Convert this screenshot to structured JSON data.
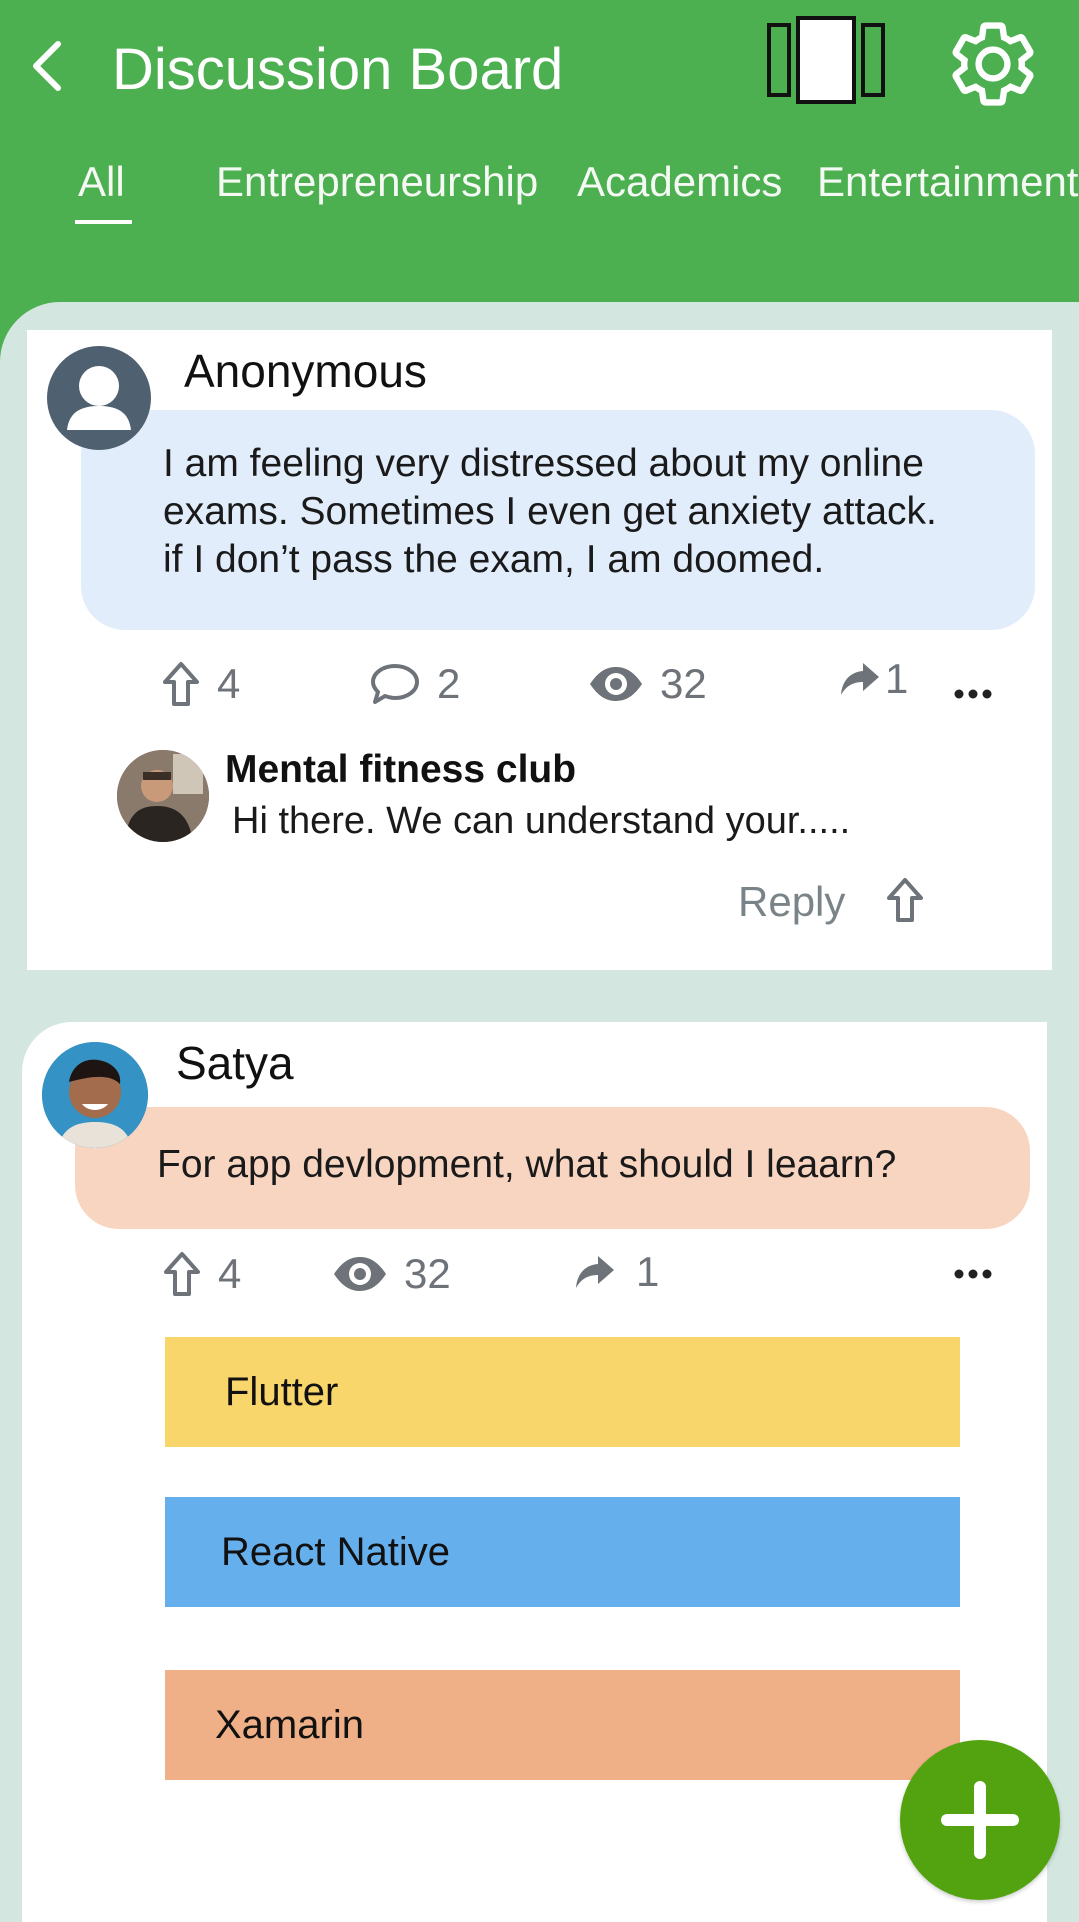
{
  "header": {
    "title": "Discussion Board",
    "tabs": [
      "All",
      "Entrepreneurship",
      "Academics",
      "Entertainment"
    ],
    "active_tab": "All"
  },
  "posts": [
    {
      "author": "Anonymous",
      "text_lines": [
        "I am feeling very distressed about my online",
        "exams. Sometimes I even get anxiety attack.",
        "if I don’t pass the exam, I am doomed."
      ],
      "upvotes": "4",
      "comments": "2",
      "views": "32",
      "shares": "1",
      "bubble_color": "#e2edfb",
      "comment": {
        "author": "Mental fitness club",
        "text": "Hi there. We can understand your.....",
        "reply_label": "Reply"
      }
    },
    {
      "author": "Satya",
      "text": "For app devlopment, what should I leaarn?",
      "upvotes": "4",
      "views": "32",
      "shares": "1",
      "bubble_color": "#f8d5c1",
      "poll_options": [
        "Flutter",
        "React Native",
        "Xamarin"
      ]
    }
  ],
  "colors": {
    "header_green": "#4caf50",
    "fab_green": "#52a30f",
    "background": "#d3e6e0",
    "flutter": "#f9d66b",
    "react_native": "#66afed",
    "xamarin": "#efb087"
  },
  "icons": {
    "back": "chevron-left-icon",
    "layout": "carousel-layout-icon",
    "settings": "gear-icon",
    "upvote": "arrow-up-outline-icon",
    "comment": "speech-bubble-icon",
    "views": "eye-icon",
    "share": "share-arrow-icon",
    "more": "ellipsis-icon",
    "fab": "plus-icon"
  }
}
